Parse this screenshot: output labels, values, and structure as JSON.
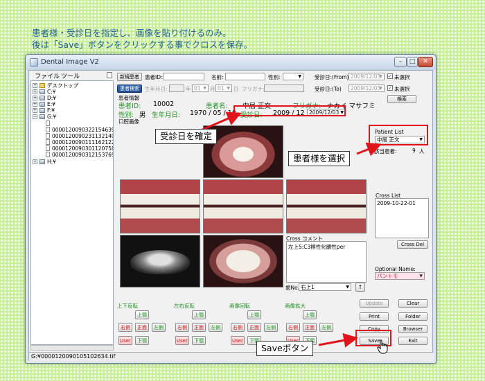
{
  "caption": {
    "line1": "患者様・受診日を指定し、画像を貼り付けるのみ。",
    "line2": "後は「Save」ボタンをクリックする事でクロスを保存。"
  },
  "window": {
    "title": "Dental Image V2",
    "controls": {
      "minimize": "–",
      "maximize": "□",
      "close": "✕"
    }
  },
  "menu": {
    "file": "ファイル",
    "tools": "ツール",
    "pin": "ㅁ"
  },
  "tree": {
    "desktop": "デスクトップ",
    "drives": [
      "C:¥",
      "D:¥",
      "E:¥",
      "F:¥",
      "G:¥",
      "H:¥"
    ],
    "files": [
      "00001200901051026​34.tif",
      "00001200903221546​39D.JPG",
      "000012009023113214​0R.JPG",
      "000012009011116212​2U.JPG",
      "000012009030112075​8C.JPG",
      "00001200903121537​69L.JPG"
    ]
  },
  "status": {
    "path": "G:¥000012009010​5102634.tif"
  },
  "search": {
    "new_patient": "新規患者",
    "patient_search": "患者検索",
    "patient_id_label": "患者ID:",
    "name_label": "名前:",
    "gender_label": "性別:",
    "birth_label": "生年月日:",
    "year_unit": "年",
    "month_value": "01",
    "month_unit": "月",
    "day_value": "01",
    "day_unit": "日",
    "furigana_label": "フリガナ:",
    "visit_from_label": "受診日:(From)",
    "visit_from_value": "2009/12/03",
    "visit_to_label": "受診日:(To)",
    "visit_to_value": "2009/12/03",
    "unselected": "未選択",
    "search_button": "検索"
  },
  "patient": {
    "section": "患者情報",
    "id_label": "患者ID:",
    "id_value": "10002",
    "name_label": "患者名:",
    "name_value": "中居 正文",
    "kana_label": "フリガナ:",
    "kana_value": "ナカイ マサフミ",
    "gender_label": "性別:",
    "gender_value": "男",
    "birth_label": "生年月日:",
    "birth_value": "1970 / 05 / 18",
    "visit_label": "受診日:",
    "visit_value": "2009 / 12 / 03",
    "visit_picker": "2009/12/03"
  },
  "image_section": {
    "label": "口腔画像"
  },
  "patient_list": {
    "label": "Patient List",
    "selected": "中居 正文",
    "count_label": "該当患者:",
    "count_value": "9",
    "count_unit": "人"
  },
  "cross_list": {
    "label": "Cross List",
    "items": [
      "2009-10-22-01"
    ],
    "delete_button": "Cross Del"
  },
  "cross_comment": {
    "label": "Cross コメント",
    "text": "左上5:C3擦性化膿性per"
  },
  "tooth": {
    "label": "歯No.",
    "value": "右上1",
    "up": "↑"
  },
  "optional_name": {
    "label": "Optional Name:",
    "value": "パントモ"
  },
  "groups": [
    {
      "title": "上下反転",
      "up": "上顎",
      "right": "右側",
      "center": "正面",
      "left": "左側",
      "user": "User",
      "down": "下顎"
    },
    {
      "title": "左右反転",
      "up": "上顎",
      "right": "右側",
      "center": "正面",
      "left": "左側",
      "user": "User",
      "down": "下顎"
    },
    {
      "title": "画像回転",
      "up": "上顎",
      "right": "右側",
      "center": "正面",
      "left": "左側",
      "user": "User",
      "down": "下顎"
    },
    {
      "title": "画像拡大",
      "up": "上顎",
      "right": "右側",
      "center": "正面",
      "left": "左側",
      "user": "User",
      "down": "下顎"
    }
  ],
  "actions": {
    "update": "Update",
    "clear": "Clear",
    "print": "Print",
    "folder": "Folder",
    "copy": "Copy",
    "browser": "Browser",
    "save": "Save",
    "exit": "Exit"
  },
  "callouts": {
    "visit_date": "受診日を確定",
    "patient_select": "患者様を選択",
    "save_button": "Saveボタン"
  },
  "colors": {
    "annotation": "#e0141a",
    "label_green": "#1f8f23",
    "accent_blue": "#1f4c8f"
  }
}
